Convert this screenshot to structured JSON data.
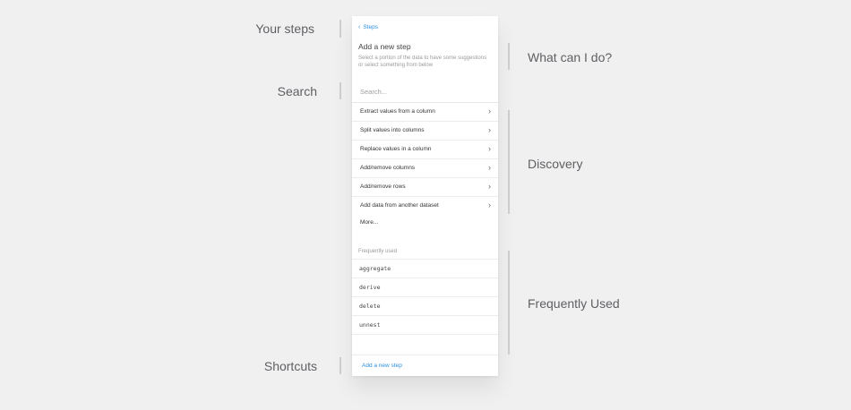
{
  "annotations": {
    "left": [
      "Your steps",
      "Search",
      "Shortcuts"
    ],
    "right": [
      "What can I do?",
      "Discovery",
      "Frequently Used"
    ]
  },
  "panel": {
    "back_label": "Steps",
    "title": "Add a new step",
    "description": "Select a portion of the data to have some suggestions or select something from below",
    "search_placeholder": "Search...",
    "actions": [
      "Extract values from a column",
      "Split values into columns",
      "Replace values in a column",
      "Add/remove columns",
      "Add/remove rows",
      "Add data from another dataset"
    ],
    "more_label": "More...",
    "frequently_used_heading": "Frequently used",
    "frequently_used": [
      "aggregate",
      "derive",
      "delete",
      "unnest"
    ],
    "footer_link": "Add a new step"
  },
  "colors": {
    "accent": "#2b8fe0",
    "background": "#f1f0f1"
  }
}
